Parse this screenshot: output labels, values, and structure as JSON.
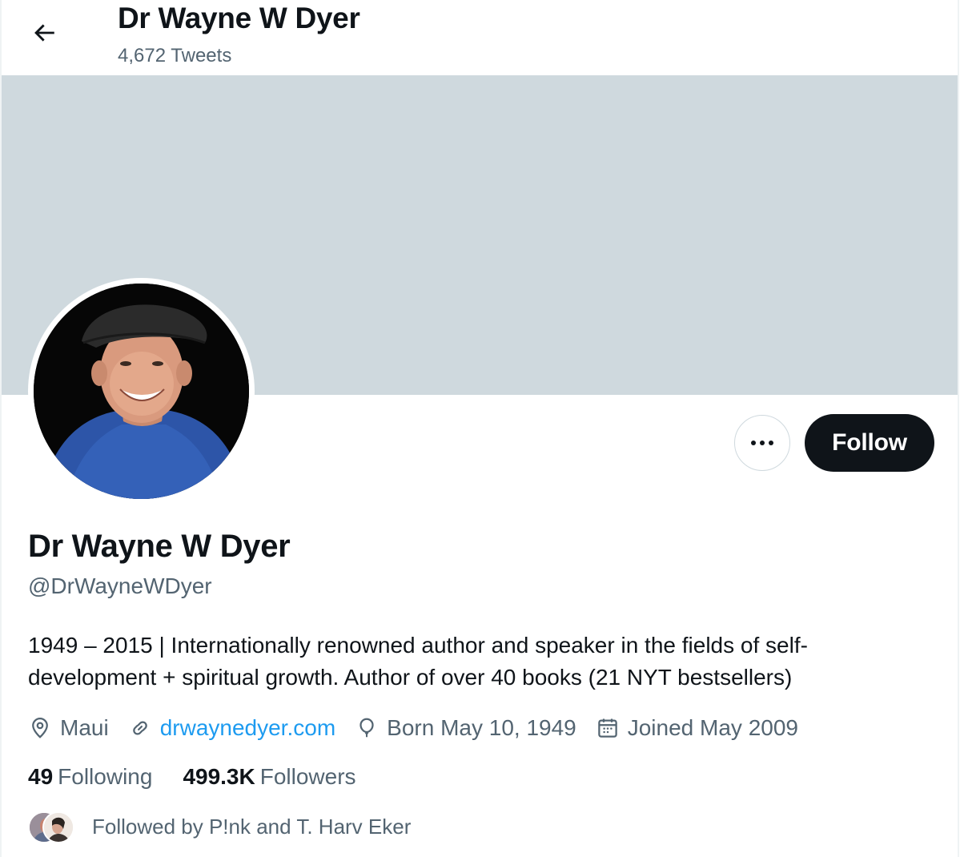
{
  "header": {
    "title": "Dr Wayne W Dyer",
    "subtitle": "4,672 Tweets",
    "back_icon": "arrow-left-icon"
  },
  "profile": {
    "name": "Dr Wayne W Dyer",
    "handle": "@DrWayneWDyer",
    "bio": "1949 – 2015 | Internationally renowned author and speaker in the fields of self-development + spiritual growth. Author of over 40 books (21 NYT bestsellers)",
    "follow_label": "Follow",
    "more_icon": "more-horizontal-icon"
  },
  "meta": {
    "location": "Maui",
    "website": "drwaynedyer.com",
    "born": "Born May 10, 1949",
    "joined": "Joined May 2009"
  },
  "stats": {
    "following_count": "49",
    "following_label": "Following",
    "followers_count": "499.3K",
    "followers_label": "Followers"
  },
  "followed_by": "Followed by P!nk and T. Harv Eker",
  "colors": {
    "banner": "#cfd9de",
    "link": "#1d9bf0",
    "follow_bg": "#0f1419",
    "secondary_text": "#536471"
  }
}
